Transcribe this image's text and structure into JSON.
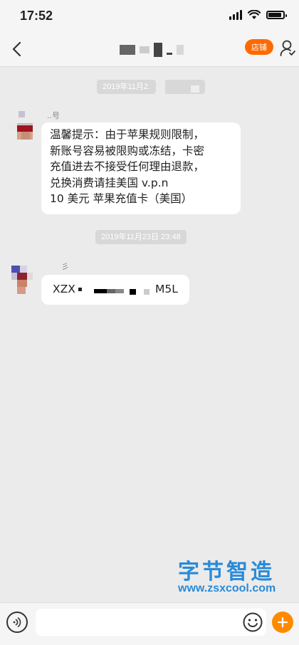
{
  "status_bar": {
    "time": "17:52"
  },
  "header": {
    "title": "",
    "shop_label": "店铺"
  },
  "messages": [
    {
      "timestamp": "2019年11月2.",
      "sender": "..号",
      "lines": [
        "温馨提示：由于苹果规则限制，",
        "新账号容易被限购或冻结，卡密",
        "充值进去不接受任何理由退款，",
        "兑换消费请挂美国 v.p.n",
        "10 美元 苹果充值卡（美国）"
      ]
    },
    {
      "timestamp": "2019年11月23日 23:48",
      "sender": "彡",
      "code_prefix": "XZX",
      "code_suffix": "M5L"
    }
  ],
  "watermark": {
    "title": "字节智造",
    "url": "www.zsxcool.com"
  },
  "input": {
    "placeholder": ""
  },
  "colors": {
    "accent": "#ff6a00",
    "plus": "#ff8a00",
    "watermark": "#2a8ad8",
    "background": "#ebebeb"
  }
}
